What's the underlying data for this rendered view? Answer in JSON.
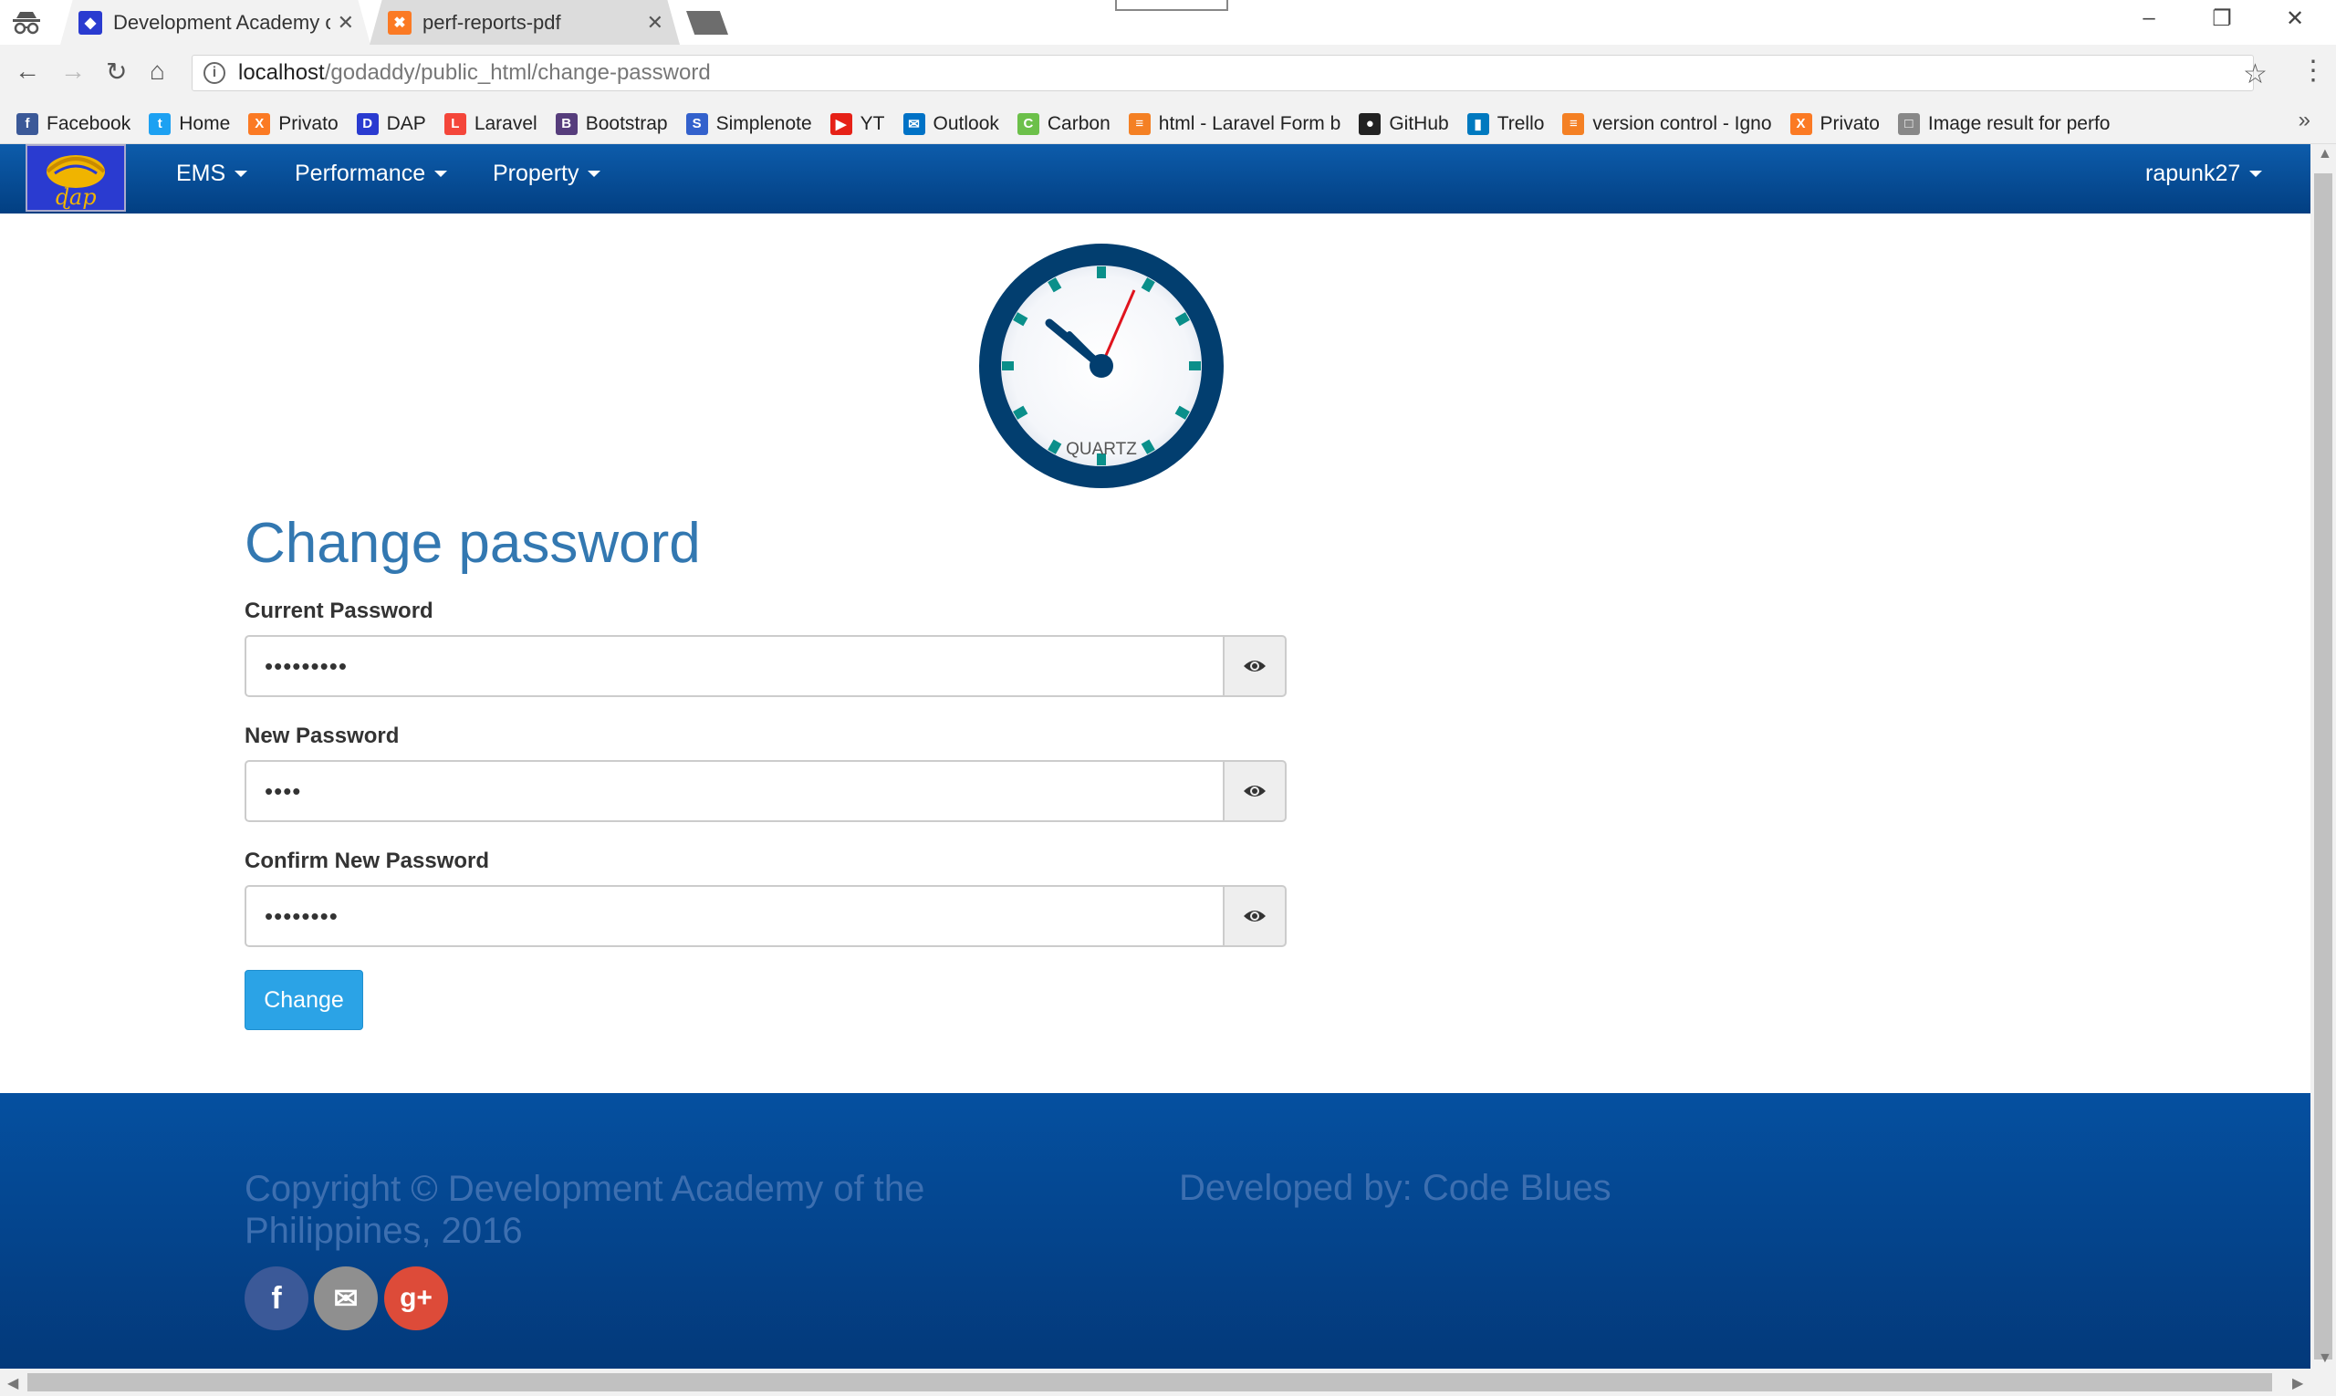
{
  "browser": {
    "tabs": [
      {
        "title": "Development Academy o",
        "favicon": "dap-favicon",
        "active": true
      },
      {
        "title": "perf-reports-pdf",
        "favicon": "xampp-favicon",
        "active": false
      }
    ],
    "url_host": "localhost",
    "url_path": "/godaddy/public_html/change-password",
    "bookmarks": [
      {
        "label": "Facebook",
        "icon": "facebook-icon",
        "color": "#3b5998",
        "glyph": "f"
      },
      {
        "label": "Home",
        "icon": "twitter-icon",
        "color": "#1da1f2",
        "glyph": "t"
      },
      {
        "label": "Privato",
        "icon": "xampp-icon",
        "color": "#fb7a24",
        "glyph": "X"
      },
      {
        "label": "DAP",
        "icon": "dap-icon",
        "color": "#2a3bd0",
        "glyph": "D"
      },
      {
        "label": "Laravel",
        "icon": "laravel-icon",
        "color": "#f4463a",
        "glyph": "L"
      },
      {
        "label": "Bootstrap",
        "icon": "bootstrap-icon",
        "color": "#563d7c",
        "glyph": "B"
      },
      {
        "label": "Simplenote",
        "icon": "simplenote-icon",
        "color": "#3361cc",
        "glyph": "S"
      },
      {
        "label": "YT",
        "icon": "youtube-icon",
        "color": "#e62117",
        "glyph": "▶"
      },
      {
        "label": "Outlook",
        "icon": "outlook-icon",
        "color": "#0072c6",
        "glyph": "✉"
      },
      {
        "label": "Carbon",
        "icon": "carbon-icon",
        "color": "#6cc04a",
        "glyph": "C"
      },
      {
        "label": "html - Laravel Form b",
        "icon": "stackoverflow-icon",
        "color": "#f48024",
        "glyph": "≡"
      },
      {
        "label": "GitHub",
        "icon": "github-icon",
        "color": "#222222",
        "glyph": "●"
      },
      {
        "label": "Trello",
        "icon": "trello-icon",
        "color": "#0079bf",
        "glyph": "▮"
      },
      {
        "label": "version control - Igno",
        "icon": "stackoverflow-icon",
        "color": "#f48024",
        "glyph": "≡"
      },
      {
        "label": "Privato",
        "icon": "xampp-icon",
        "color": "#fb7a24",
        "glyph": "X"
      },
      {
        "label": "Image result for perfo",
        "icon": "page-icon",
        "color": "#888888",
        "glyph": "□"
      }
    ]
  },
  "navbar": {
    "items": [
      "EMS",
      "Performance",
      "Property"
    ],
    "user": "rapunk27"
  },
  "clock": {
    "label": "QUARTZ",
    "ring_color": "#023e6f",
    "tick_color": "#0a8f8a",
    "second_hand_color": "#e0141e"
  },
  "form": {
    "title": "Change password",
    "current_label": "Current Password",
    "current_value": "•••••••••",
    "new_label": "New Password",
    "new_value": "••••",
    "confirm_label": "Confirm New Password",
    "confirm_value": "••••••••",
    "submit_label": "Change"
  },
  "footer": {
    "copyright": "Copyright © Development Academy of the Philippines, 2016",
    "developer": "Developed by: Code Blues",
    "social": [
      {
        "name": "facebook",
        "glyph": "f",
        "color": "#3b5998"
      },
      {
        "name": "email",
        "glyph": "✉",
        "color": "#8f8f8f"
      },
      {
        "name": "google-plus",
        "glyph": "g+",
        "color": "#dd4b39"
      }
    ]
  }
}
